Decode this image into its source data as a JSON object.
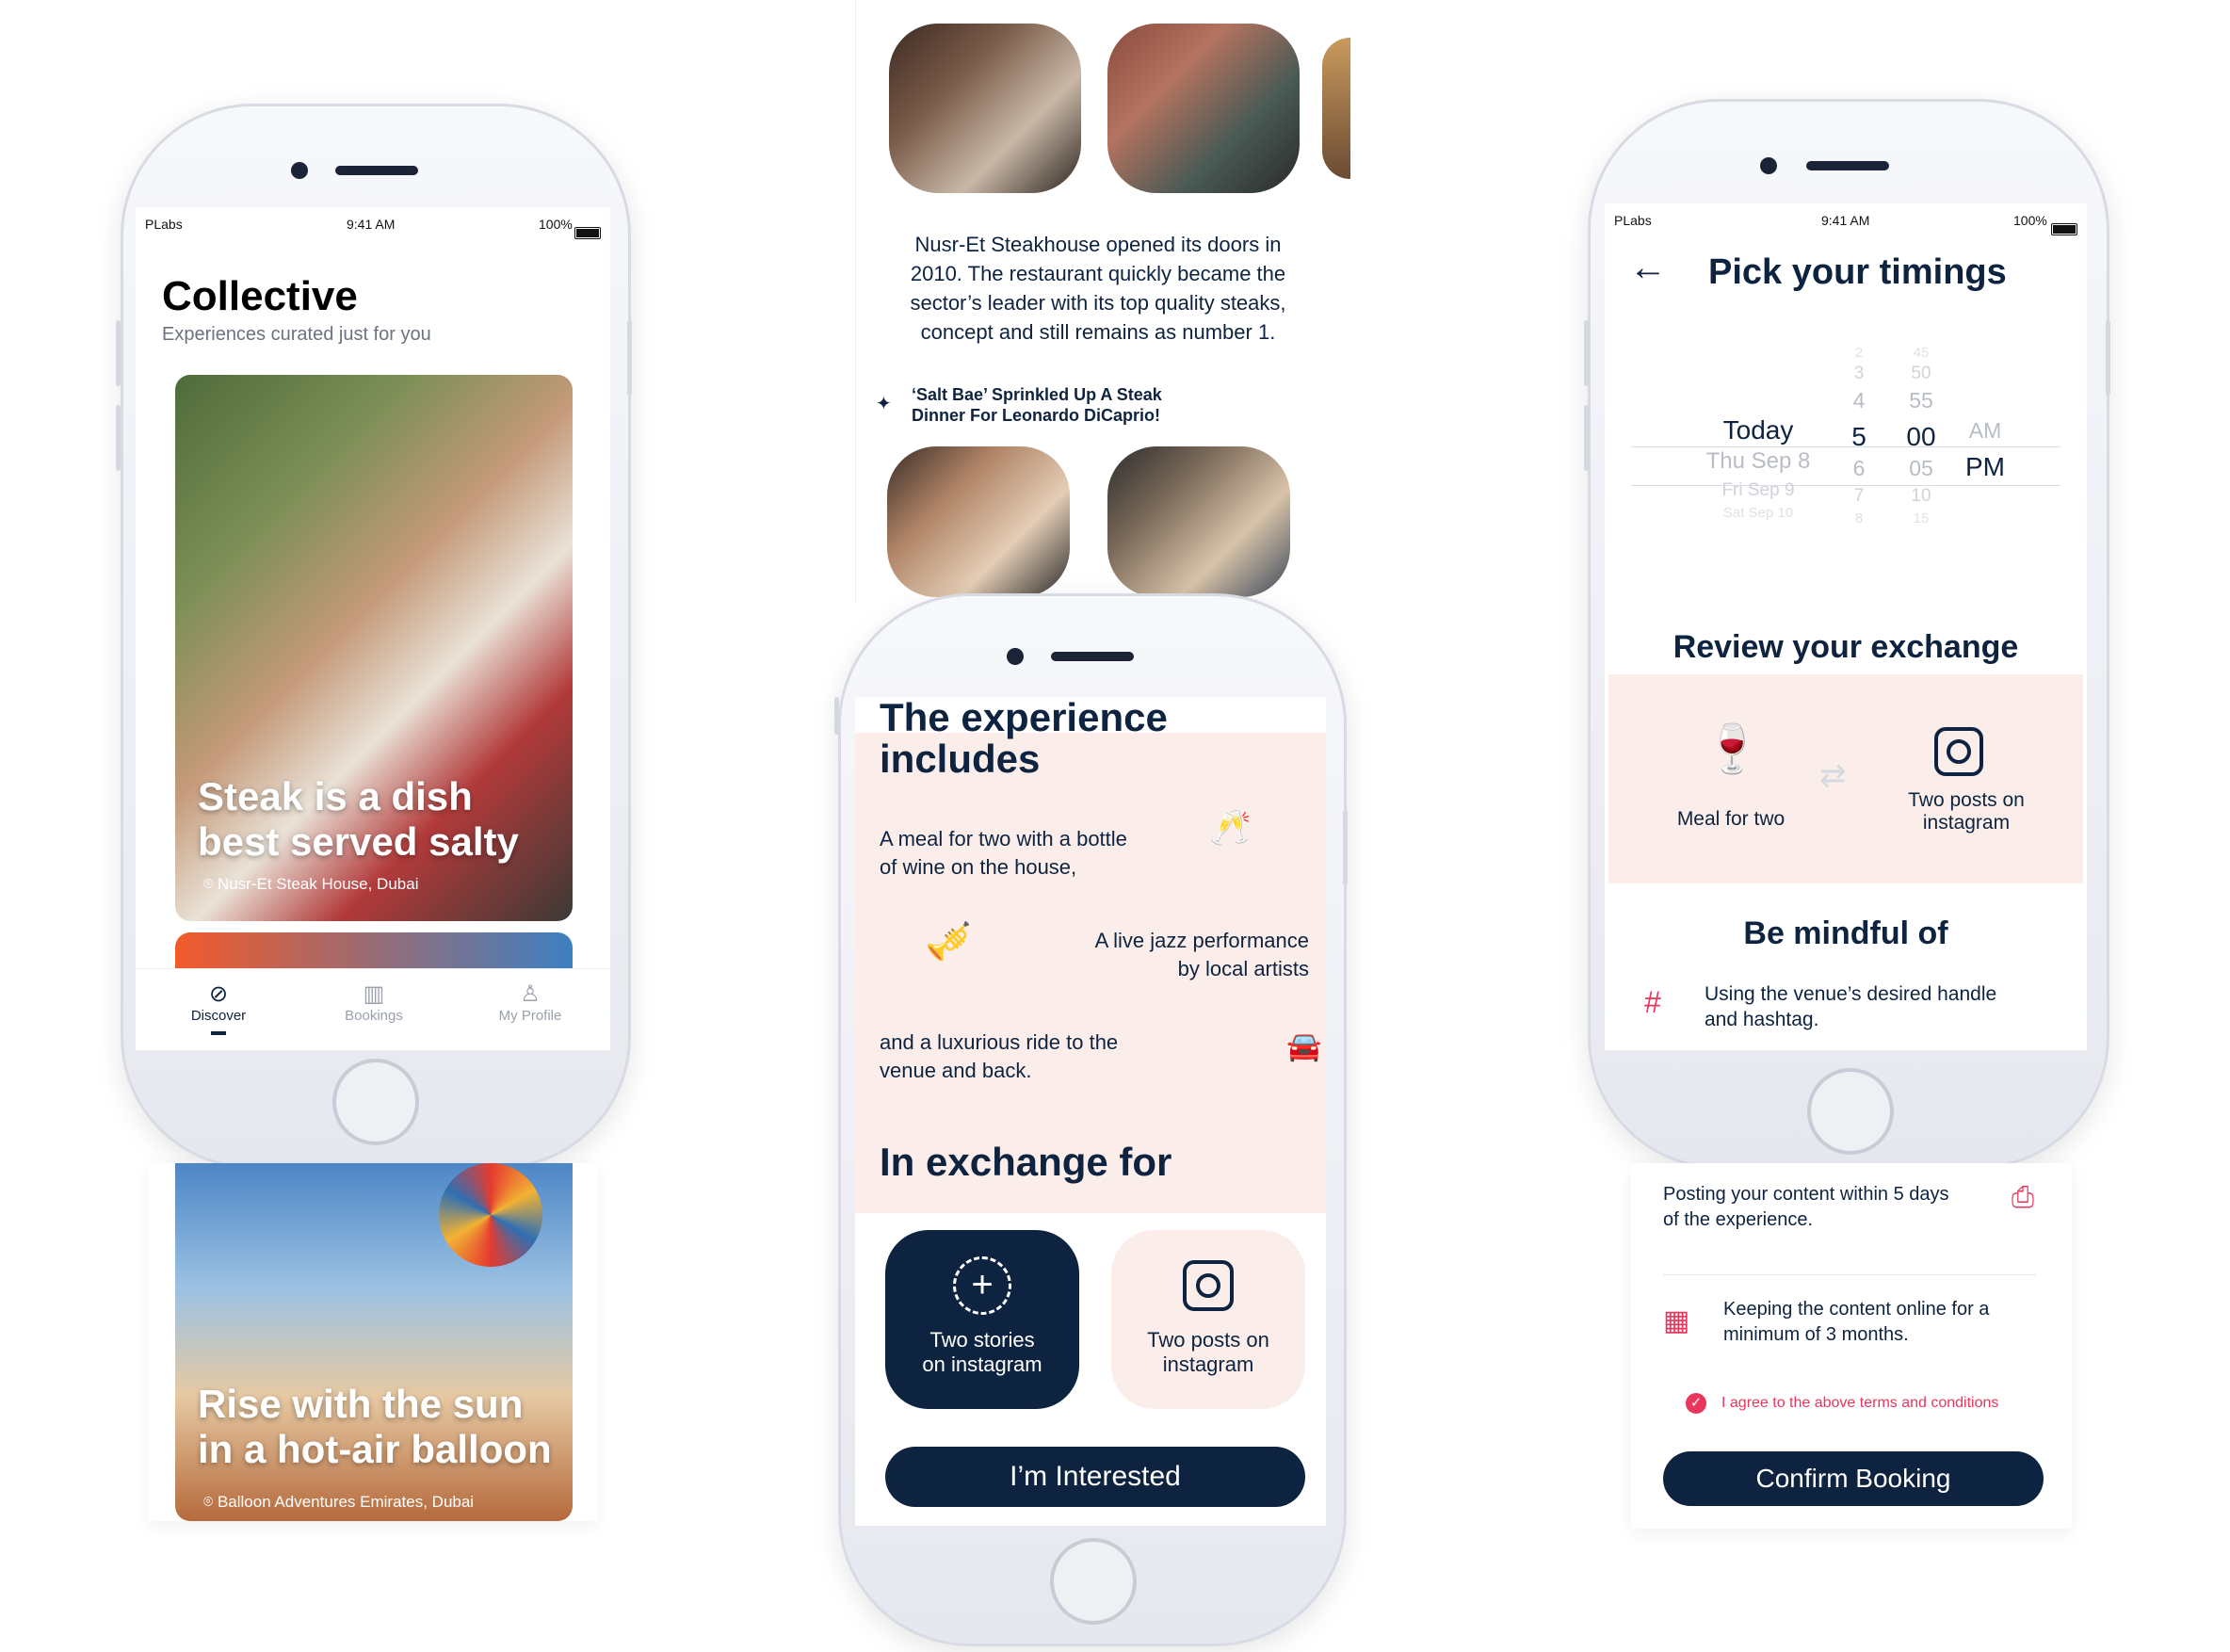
{
  "screen1": {
    "status": {
      "carrier": "PLabs",
      "time": "9:41 AM",
      "battery": "100%"
    },
    "title": "Collective",
    "subtitle": "Experiences curated just for you",
    "card1": {
      "caption_line1": "Steak is a dish",
      "caption_line2": "best served salty",
      "location": "Nusr-Et Steak House, Dubai"
    },
    "card2": {
      "caption_line1": "Rise with the sun",
      "caption_line2": "in a hot-air balloon",
      "location": "Balloon Adventures Emirates, Dubai"
    },
    "tabs": [
      {
        "label": "Discover",
        "icon": "compass-icon"
      },
      {
        "label": "Bookings",
        "icon": "building-icon"
      },
      {
        "label": "My Profile",
        "icon": "person-icon"
      }
    ]
  },
  "screen2": {
    "description": "Nusr-Et Steakhouse opened its doors in 2010. The restaurant quickly became the sector’s leader with its top quality steaks, concept and still remains as number 1.",
    "desc_lines": [
      "Nusr-Et Steakhouse opened its doors in",
      "2010. The restaurant quickly became the",
      "sector’s leader with its top quality steaks,",
      "concept and still remains as number 1."
    ],
    "highlight_line1": "‘Salt Bae’ Sprinkled Up A Steak",
    "highlight_line2": "Dinner For Leonardo DiCaprio!",
    "includes_title_line1": "The experience",
    "includes_title_line2": "includes",
    "item1_line1": "A meal for two with a bottle",
    "item1_line2": "of wine on the house,",
    "item2_line1": "A live jazz performance",
    "item2_line2": "by local artists",
    "item3_line1": "and a luxurious ride to the",
    "item3_line2": "venue and back.",
    "exchange_title": "In exchange for",
    "exchange1_line1": "Two stories",
    "exchange1_line2": "on instagram",
    "exchange2_line1": "Two posts on",
    "exchange2_line2": "instagram",
    "cta": "I’m Interested"
  },
  "screen3": {
    "status": {
      "carrier": "PLabs",
      "time": "9:41 AM",
      "battery": "100%"
    },
    "title": "Pick your timings",
    "picker": {
      "days": [
        "",
        "",
        "Today",
        "Thu Sep 8",
        "Fri Sep 9",
        "Sat Sep 10"
      ],
      "hours": [
        "2",
        "3",
        "4",
        "5",
        "6",
        "7",
        "8"
      ],
      "minutes": [
        "45",
        "50",
        "55",
        "00",
        "05",
        "10",
        "15"
      ],
      "ampm": [
        "AM",
        "PM"
      ]
    },
    "review_title": "Review your exchange",
    "give_label": "Meal for two",
    "get_line1": "Two posts on",
    "get_line2": "instagram",
    "mindful_title": "Be mindful of",
    "rule1_line1": "Using the venue’s desired handle",
    "rule1_line2": "and hashtag.",
    "rule2_line1": "Posting your content within 5 days",
    "rule2_line2": "of the experience.",
    "rule3_line1": "Keeping the content online for a",
    "rule3_line2": "minimum of 3 months.",
    "agree": "I agree to the above terms and conditions",
    "cta": "Confirm Booking"
  },
  "colors": {
    "navy": "#0d2340",
    "pink": "#fbeeea",
    "accent": "#e8365d"
  }
}
